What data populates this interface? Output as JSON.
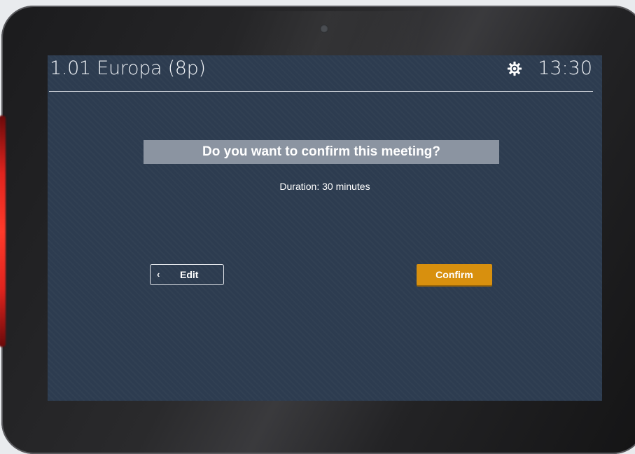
{
  "header": {
    "room_name": "1.01 Europa (8p)",
    "time": "13:30",
    "settings_icon": "gear-icon"
  },
  "dialog": {
    "question": "Do you want to confirm this meeting?",
    "duration": "Duration: 30 minutes"
  },
  "actions": {
    "edit_label": "Edit",
    "edit_icon": "chevron-left-icon",
    "confirm_label": "Confirm"
  },
  "colors": {
    "screen_background": "#2d3c50",
    "banner": "#8b94a1",
    "confirm_accent": "#d8900e",
    "status_led": "#e0241e"
  }
}
